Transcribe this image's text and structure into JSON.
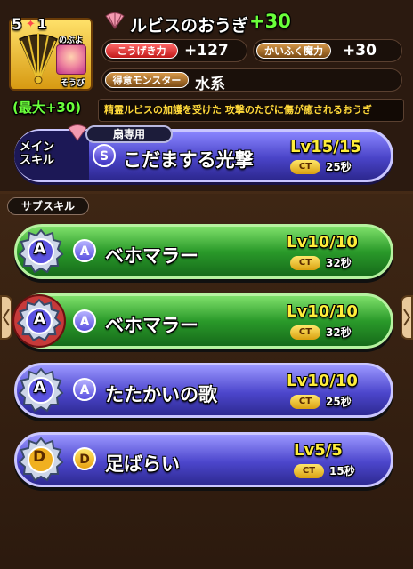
{
  "weapon": {
    "level": "5",
    "plus_mark": "✦",
    "plus_count": "1",
    "owner": "のぶよ",
    "equipped": "そうび",
    "max_bonus": "(最大+30)",
    "name": "ルビスのおうぎ",
    "plus_value": "+30",
    "stats": {
      "attack_label": "こうげき力",
      "attack_value": "+127",
      "heal_label": "かいふく魔力",
      "heal_value": "+30",
      "monster_label": "得意モンスター",
      "monster_value": "水系"
    },
    "description": "精霊ルビスの加護を受けた 攻撃のたびに傷が癒されるおうぎ"
  },
  "main_skill": {
    "tag_line1": "メイン",
    "tag_line2": "スキル",
    "category": "扇専用",
    "rank": "S",
    "name": "こだまする光撃",
    "level": "Lv15/15",
    "ct_label": "CT",
    "ct_value": "25秒"
  },
  "sub_skills": {
    "header": "サブスキル",
    "items": [
      {
        "slot_rank": "A",
        "rank": "A",
        "name": "ベホマラー",
        "level": "Lv10/10",
        "ct_label": "CT",
        "ct_value": "32秒",
        "color": "green"
      },
      {
        "slot_rank": "A",
        "rank": "A",
        "name": "ベホマラー",
        "level": "Lv10/10",
        "ct_label": "CT",
        "ct_value": "32秒",
        "color": "green"
      },
      {
        "slot_rank": "A",
        "rank": "A",
        "name": "たたかいの歌",
        "level": "Lv10/10",
        "ct_label": "CT",
        "ct_value": "25秒",
        "color": "blue"
      },
      {
        "slot_rank": "D",
        "rank": "D",
        "name": "足ばらい",
        "level": "Lv5/5",
        "ct_label": "CT",
        "ct_value": "15秒",
        "color": "blue"
      }
    ]
  },
  "icons": {
    "fan": "fan-icon",
    "gear": "gear-slot-icon",
    "left": "left-arrow-icon",
    "right": "right-arrow-icon"
  },
  "colors": {
    "green_bar": "#2a9a2a",
    "blue_bar": "#4c46cc",
    "level_text": "#ffee3a",
    "plus_text": "#6aff3a",
    "description_text": "#ffd93a"
  }
}
